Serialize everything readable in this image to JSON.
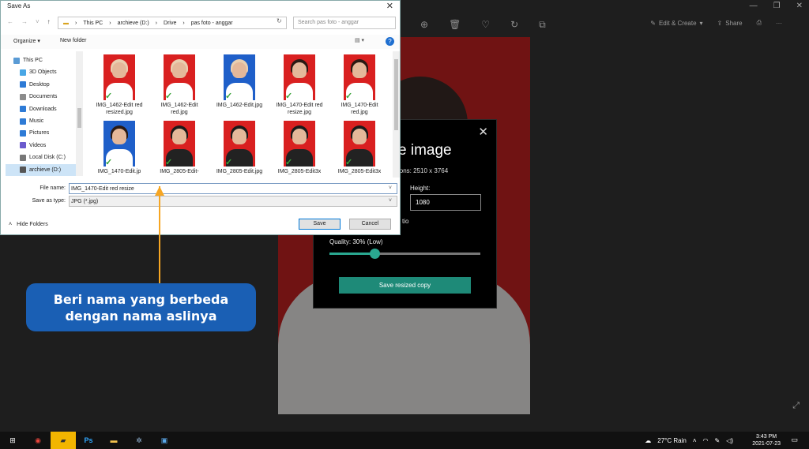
{
  "photos_toolbar": {
    "edit_create": "Edit & Create",
    "share": "Share",
    "window_controls": [
      "—",
      "❐",
      "✕"
    ]
  },
  "resize_panel": {
    "title": "e image",
    "dimensions": "ions: 2510 x 3764",
    "height_label": "Height:",
    "height_value": "1080",
    "ratio_text": "tio",
    "quality_label": "Quality: 30% (Low)",
    "quality_value": 0.3,
    "save_button": "Save resized copy"
  },
  "dialog": {
    "title": "Save As",
    "breadcrumb": [
      "This PC",
      "archieve (D:)",
      "Drive",
      "pas foto - anggar"
    ],
    "search_placeholder": "Search pas foto - anggar",
    "organize": "Organize ▾",
    "new_folder": "New folder",
    "nav_items": [
      {
        "label": "This PC",
        "color": "#5a9bd5"
      },
      {
        "label": "3D Objects",
        "color": "#49a7e6"
      },
      {
        "label": "Desktop",
        "color": "#2e7bd6"
      },
      {
        "label": "Documents",
        "color": "#8c8c8c"
      },
      {
        "label": "Downloads",
        "color": "#2e7bd6"
      },
      {
        "label": "Music",
        "color": "#2e7bd6"
      },
      {
        "label": "Pictures",
        "color": "#2e7bd6"
      },
      {
        "label": "Videos",
        "color": "#6a5acd"
      },
      {
        "label": "Local Disk (C:)",
        "color": "#777777"
      },
      {
        "label": "archieve (D:)",
        "color": "#555555"
      }
    ],
    "files": [
      {
        "name": "IMG_1462-Edit red resized.jpg",
        "bg": "#d92020",
        "hair": "#e9cfb0",
        "body": "#ffffff"
      },
      {
        "name": "IMG_1462-Edit red.jpg",
        "bg": "#d92020",
        "hair": "#e9cfb0",
        "body": "#ffffff"
      },
      {
        "name": "IMG_1462-Edit.jpg",
        "bg": "#1f5fc9",
        "hair": "#e9cfb0",
        "body": "#ffffff"
      },
      {
        "name": "IMG_1470-Edit red resize.jpg",
        "bg": "#d92020",
        "hair": "#2a1a14",
        "body": "#ffffff"
      },
      {
        "name": "IMG_1470-Edit red.jpg",
        "bg": "#d92020",
        "hair": "#2a1a14",
        "body": "#ffffff"
      },
      {
        "name": "IMG_1470-Edit.jp",
        "bg": "#1f5fc9",
        "hair": "#2a1a14",
        "body": "#ffffff"
      },
      {
        "name": "IMG_2805-Edit-",
        "bg": "#d92020",
        "hair": "#1a1a1a",
        "body": "#222222"
      },
      {
        "name": "IMG_2805-Edit.jpg",
        "bg": "#d92020",
        "hair": "#1a1a1a",
        "body": "#222222"
      },
      {
        "name": "IMG_2805-Edit3x",
        "bg": "#d92020",
        "hair": "#1a1a1a",
        "body": "#222222"
      },
      {
        "name": "IMG_2805-Edit3x",
        "bg": "#d92020",
        "hair": "#1a1a1a",
        "body": "#222222"
      }
    ],
    "file_name_label": "File name:",
    "file_name_value": "IMG_1470-Edit red resize",
    "save_as_type_label": "Save as type:",
    "save_as_type_value": "JPG (*.jpg)",
    "hide_folders": "Hide Folders",
    "save_button": "Save",
    "cancel_button": "Cancel"
  },
  "callout": {
    "line1": "Beri nama yang berbeda",
    "line2": "dengan nama aslinya",
    "color": "#1a5fb4",
    "arrow_color": "#f6a623"
  },
  "taskbar": {
    "weather": "27°C  Rain",
    "time": "3:43 PM",
    "date": "2021-07-23"
  }
}
